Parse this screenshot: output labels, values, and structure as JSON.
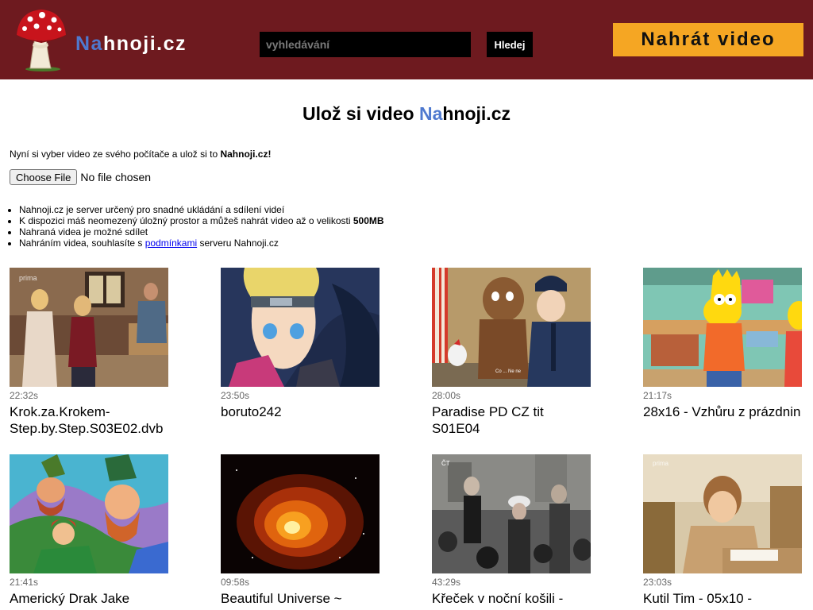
{
  "header": {
    "logo_text_highlight": "Na",
    "logo_text_rest": "hnoji.cz",
    "search_placeholder": "vyhledávání",
    "search_button": "Hledej",
    "upload_button": "Nahrát video"
  },
  "upload": {
    "title_prefix": "Ulož si video ",
    "title_highlight": "Na",
    "title_rest": "hnoji.cz",
    "intro_text": "Nyní si vyber video ze svého počítače a ulož si to ",
    "intro_bold": "Nahnoji.cz!",
    "file_button": "Choose File",
    "file_status": "No file chosen",
    "info": {
      "item1": "Nahnoji.cz je server určený pro snadné ukládání a sdílení videí",
      "item2_text": "K dispozici máš neomezený úložný prostor a můžeš nahrát video až o velikosti ",
      "item2_bold": "500MB",
      "item3": "Nahraná videa je možné sdílet",
      "item4_prefix": "Nahráním videa, souhlasíte s ",
      "item4_link": "podmínkami",
      "item4_suffix": " serveru Nahnoji.cz"
    }
  },
  "videos": [
    {
      "duration": "22:32s",
      "title": "Krok.za.Krokem-Step.by.Step.S03E02.dvb",
      "thumb": "sitcom-kitchen-scene"
    },
    {
      "duration": "23:50s",
      "title": "boruto242",
      "thumb": "anime-boy"
    },
    {
      "duration": "28:00s",
      "title": "Paradise PD CZ tit S01E04",
      "thumb": "cartoon-dog-police"
    },
    {
      "duration": "21:17s",
      "title": "28x16 - Vzhůru z prázdnin",
      "thumb": "cartoon-classroom"
    },
    {
      "duration": "21:41s",
      "title": "Americký Drak Jake",
      "thumb": "cartoon-leprechauns"
    },
    {
      "duration": "09:58s",
      "title": "Beautiful Universe ~",
      "thumb": "space-nebula"
    },
    {
      "duration": "43:29s",
      "title": "Křeček v noční košili -",
      "thumb": "crowd-street"
    },
    {
      "duration": "23:03s",
      "title": "Kutil Tim - 05x10 -",
      "thumb": "boy-writing"
    }
  ],
  "colors": {
    "header_bg": "#6e1a1f",
    "accent_blue": "#4f79cf",
    "upload_button_bg": "#f5a623"
  }
}
